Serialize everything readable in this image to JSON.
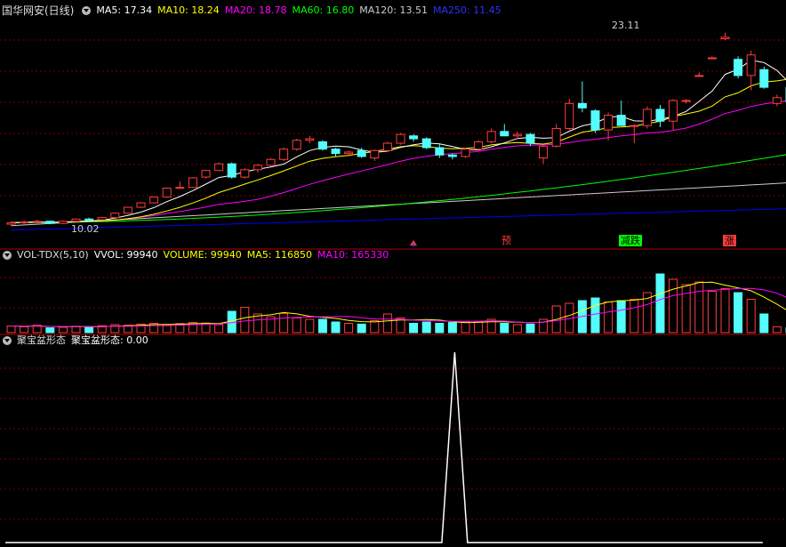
{
  "colors": {
    "up": "#ff3c3c",
    "down": "#54fcfc",
    "ma5": "#ffffff",
    "ma10": "#ffff00",
    "ma20": "#ff00ff",
    "ma60": "#00ff00",
    "ma120": "#cccccc",
    "ma250": "#0000ff",
    "grid": "#7a0000"
  },
  "price_panel": {
    "title": "国华网安(日线)",
    "ma5": "MA5: 17.34",
    "ma10": "MA10: 18.24",
    "ma20": "MA20: 18.78",
    "ma60": "MA60: 16.80",
    "ma120": "MA120: 13.51",
    "ma250": "MA250: 11.45",
    "high_label": "23.11",
    "low_label": "10.02"
  },
  "signals": [
    {
      "text": "预",
      "color": "#ff3c3c"
    },
    {
      "text": "减跌",
      "color": "#00ff00"
    },
    {
      "text": "涨",
      "color": "#ff3c3c"
    }
  ],
  "volume_panel": {
    "title": "VOL-TDX(5,10)",
    "vvol": "VVOL: 99940",
    "volume": "VOLUME: 99940",
    "ma5": "MA5: 116850",
    "ma10": "MA10: 165330"
  },
  "pattern_panel": {
    "title": "聚宝盆形态",
    "value": "聚宝盆形态: 0.00"
  },
  "chart_data": {
    "type": "candlestick",
    "ohlc": [
      [
        10.1,
        10.3,
        10.0,
        10.2
      ],
      [
        10.2,
        10.35,
        10.1,
        10.25
      ],
      [
        10.25,
        10.4,
        10.15,
        10.3
      ],
      [
        10.3,
        10.35,
        10.1,
        10.15
      ],
      [
        10.15,
        10.35,
        10.1,
        10.3
      ],
      [
        10.3,
        10.5,
        10.2,
        10.45
      ],
      [
        10.45,
        10.55,
        10.3,
        10.4
      ],
      [
        10.4,
        10.6,
        10.35,
        10.55
      ],
      [
        10.55,
        10.9,
        10.5,
        10.85
      ],
      [
        10.85,
        11.3,
        10.8,
        11.25
      ],
      [
        11.25,
        11.6,
        11.2,
        11.55
      ],
      [
        11.55,
        12.0,
        11.5,
        11.95
      ],
      [
        11.95,
        12.6,
        11.9,
        12.55
      ],
      [
        12.55,
        13.0,
        12.5,
        12.6
      ],
      [
        12.6,
        13.3,
        12.55,
        13.25
      ],
      [
        13.3,
        13.8,
        13.2,
        13.75
      ],
      [
        13.75,
        14.3,
        13.7,
        14.2
      ],
      [
        14.2,
        14.3,
        13.2,
        13.3
      ],
      [
        13.3,
        13.9,
        13.2,
        13.8
      ],
      [
        13.8,
        14.2,
        13.6,
        14.1
      ],
      [
        14.1,
        14.6,
        14.0,
        14.5
      ],
      [
        14.5,
        15.3,
        14.4,
        15.2
      ],
      [
        15.2,
        15.9,
        15.1,
        15.8
      ],
      [
        15.8,
        16.1,
        15.6,
        15.9
      ],
      [
        15.7,
        15.8,
        15.1,
        15.2
      ],
      [
        15.2,
        15.3,
        14.7,
        14.9
      ],
      [
        14.9,
        15.1,
        14.7,
        15.0
      ],
      [
        15.1,
        15.3,
        14.6,
        14.7
      ],
      [
        14.6,
        15.2,
        14.4,
        15.1
      ],
      [
        15.1,
        15.7,
        15.0,
        15.6
      ],
      [
        15.6,
        16.3,
        15.5,
        16.2
      ],
      [
        16.1,
        16.2,
        15.7,
        15.9
      ],
      [
        15.9,
        16.0,
        15.2,
        15.3
      ],
      [
        15.3,
        15.6,
        14.6,
        14.8
      ],
      [
        14.8,
        14.9,
        14.5,
        14.7
      ],
      [
        14.7,
        15.3,
        14.6,
        15.2
      ],
      [
        15.2,
        15.8,
        15.1,
        15.7
      ],
      [
        15.7,
        16.6,
        15.6,
        16.4
      ],
      [
        16.4,
        16.9,
        16.3,
        16.1
      ],
      [
        16.1,
        16.4,
        15.9,
        16.2
      ],
      [
        16.2,
        16.3,
        15.4,
        15.6
      ],
      [
        14.6,
        15.5,
        14.2,
        15.4
      ],
      [
        15.4,
        16.9,
        15.3,
        16.6
      ],
      [
        16.6,
        18.6,
        16.5,
        18.3
      ],
      [
        18.3,
        19.8,
        17.7,
        18.0
      ],
      [
        17.8,
        17.9,
        16.3,
        16.5
      ],
      [
        16.5,
        17.7,
        15.8,
        17.5
      ],
      [
        17.5,
        18.5,
        17.3,
        16.8
      ],
      [
        16.8,
        16.9,
        15.6,
        16.8
      ],
      [
        16.8,
        18.1,
        16.6,
        17.9
      ],
      [
        17.9,
        18.2,
        16.7,
        17.1
      ],
      [
        17.1,
        18.6,
        16.5,
        18.5
      ],
      [
        18.5,
        18.6,
        18.3,
        18.5
      ],
      [
        20.2,
        20.4,
        20.1,
        20.2
      ],
      [
        21.4,
        21.5,
        21.3,
        21.4
      ],
      [
        22.7,
        23.11,
        22.6,
        22.8
      ],
      [
        21.3,
        21.5,
        20.0,
        20.2
      ],
      [
        20.2,
        21.9,
        19.2,
        21.6
      ],
      [
        20.6,
        20.8,
        19.3,
        19.4
      ],
      [
        18.3,
        18.9,
        18.1,
        18.7
      ],
      [
        19.4,
        19.5,
        18.2,
        18.4
      ],
      [
        17.9,
        19.0,
        17.7,
        18.8
      ],
      [
        18.8,
        19.8,
        18.6,
        19.4
      ],
      [
        20.0,
        21.2,
        19.5,
        19.3
      ],
      [
        19.5,
        19.6,
        18.8,
        18.8
      ],
      [
        19.0,
        19.4,
        18.5,
        18.7
      ],
      [
        19.0,
        19.1,
        18.3,
        18.4
      ],
      [
        18.6,
        19.4,
        18.5,
        19.3
      ],
      [
        19.3,
        20.0,
        19.2,
        19.8
      ],
      [
        19.8,
        20.3,
        19.5,
        20.1
      ],
      [
        20.1,
        21.2,
        20.0,
        20.5
      ],
      [
        20.1,
        20.7,
        19.7,
        20.5
      ],
      [
        20.5,
        21.5,
        20.3,
        21.3
      ]
    ],
    "volume": [
      25,
      22,
      28,
      18,
      20,
      24,
      22,
      26,
      30,
      28,
      32,
      35,
      30,
      34,
      38,
      36,
      30,
      80,
      95,
      70,
      60,
      72,
      55,
      50,
      50,
      40,
      35,
      32,
      45,
      70,
      55,
      35,
      40,
      35,
      38,
      40,
      40,
      50,
      35,
      30,
      32,
      50,
      100,
      110,
      120,
      130,
      115,
      120,
      125,
      150,
      220,
      200,
      180,
      190,
      155,
      165,
      150,
      125,
      70,
      22,
      18,
      180,
      250,
      210,
      185,
      200,
      135,
      130,
      210,
      195,
      160,
      150,
      140,
      160,
      205,
      210,
      185,
      200,
      215,
      190,
      175,
      190,
      195,
      200,
      205,
      210,
      215,
      220
    ],
    "pattern": [
      0,
      0,
      0,
      0,
      0,
      0,
      0,
      0,
      0,
      0,
      0,
      0,
      0,
      0,
      0,
      0,
      0,
      0,
      0,
      0,
      0,
      0,
      0,
      0,
      0,
      0,
      0,
      0,
      0,
      0,
      0,
      0,
      0,
      0,
      0,
      1,
      0,
      0,
      0,
      0,
      0,
      0,
      0,
      0,
      0,
      0,
      0,
      0,
      0,
      0,
      0,
      0,
      0,
      0,
      0,
      0,
      0,
      0,
      0,
      0
    ]
  }
}
